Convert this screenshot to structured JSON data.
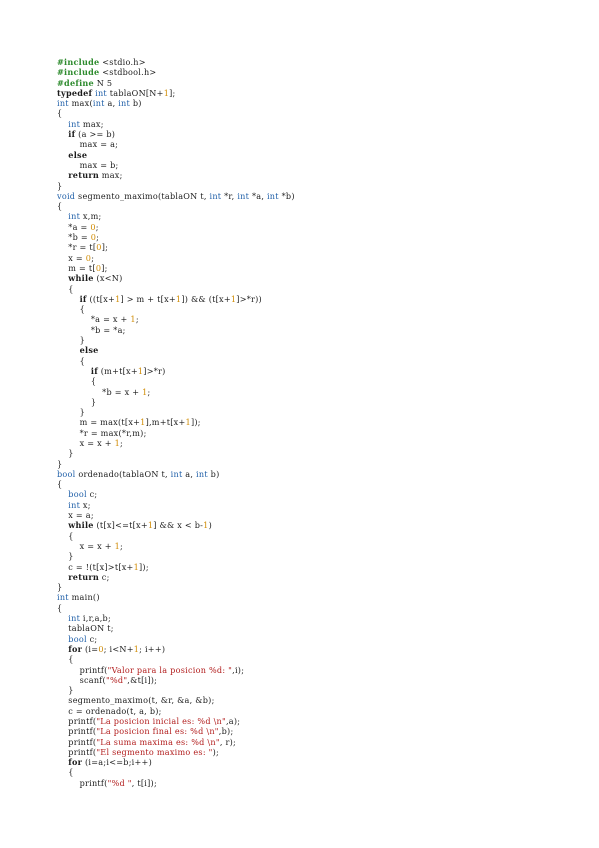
{
  "document": {
    "code_lines": [
      "#include <stdio.h>",
      "#include <stdbool.h>",
      "#define N 5",
      "typedef int tablaON[N+1];",
      "int max(int a, int b)",
      "{",
      "    int max;",
      "    if (a >= b)",
      "        max = a;",
      "    else",
      "        max = b;",
      "    return max;",
      "}",
      "void segmento_maximo(tablaON t, int *r, int *a, int *b)",
      "{",
      "    int x,m;",
      "    *a = 0;",
      "    *b = 0;",
      "    *r = t[0];",
      "    x = 0;",
      "    m = t[0];",
      "    while (x<N)",
      "    {",
      "        if ((t[x+1] > m + t[x+1]) && (t[x+1]>*r))",
      "        {",
      "            *a = x + 1;",
      "            *b = *a;",
      "        }",
      "        else",
      "        {",
      "            if (m+t[x+1]>*r)",
      "            {",
      "                *b = x + 1;",
      "            }",
      "        }",
      "        m = max(t[x+1],m+t[x+1]);",
      "        *r = max(*r,m);",
      "        x = x + 1;",
      "    }",
      "}",
      "bool ordenado(tablaON t, int a, int b)",
      "{",
      "    bool c;",
      "    int x;",
      "    x = a;",
      "    while (t[x]<=t[x+1] && x < b-1)",
      "    {",
      "        x = x + 1;",
      "    }",
      "    c = !(t[x]>t[x+1]);",
      "    return c;",
      "}",
      "int main()",
      "{",
      "    int i,r,a,b;",
      "    tablaON t;",
      "    bool c;",
      "    for (i=0; i<N+1; i++)",
      "    {",
      "        printf(\"Valor para la posicion %d: \",i);",
      "        scanf(\"%d\",&t[i]);",
      "    }",
      "    segmento_maximo(t, &r, &a, &b);",
      "    c = ordenado(t, a, b);",
      "    printf(\"La posicion inicial es: %d \\n\",a);",
      "    printf(\"La posicion final es: %d \\n\",b);",
      "    printf(\"La suma maxima es: %d \\n\", r);",
      "    printf(\"El segmento maximo es: \");",
      "    for (i=a;i<=b;i++)",
      "    {",
      "        printf(\"%d \", t[i]);"
    ]
  }
}
